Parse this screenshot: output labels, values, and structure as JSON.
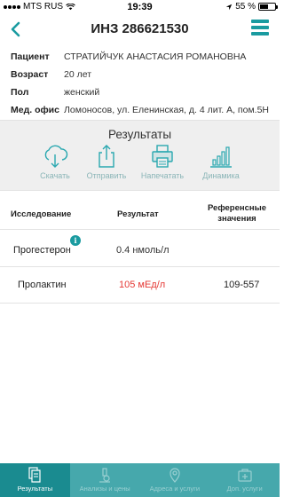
{
  "status_bar": {
    "carrier": "MTS RUS",
    "time": "19:39",
    "battery": "55 %",
    "battery_level": 0.55
  },
  "header": {
    "title": "ИНЗ 286621530"
  },
  "patient": {
    "rows": [
      {
        "label": "Пациент",
        "value": "СТРАТИЙЧУК АНАСТАСИЯ РОМАНОВНА"
      },
      {
        "label": "Возраст",
        "value": "20 лет"
      },
      {
        "label": "Пол",
        "value": "женский"
      },
      {
        "label": "Мед. офис",
        "value": "Ломоносов, ул. Еленинская, д. 4 лит. А, пом.5Н"
      }
    ]
  },
  "results_panel": {
    "title": "Результаты",
    "actions": [
      {
        "label": "Скачать",
        "icon": "cloud-download-icon"
      },
      {
        "label": "Отправить",
        "icon": "share-icon"
      },
      {
        "label": "Напечатать",
        "icon": "printer-icon"
      },
      {
        "label": "Динамика",
        "icon": "bar-chart-icon"
      }
    ]
  },
  "table": {
    "headers": {
      "study": "Исследование",
      "result": "Результат",
      "reference": "Референсные значения"
    },
    "rows": [
      {
        "study": "Прогестерон",
        "result": "0.4 нмоль/л",
        "reference": "",
        "info_badge": "i",
        "result_color": "#333333"
      },
      {
        "study": "Пролактин",
        "result": "105 мЕд/л",
        "reference": "109-557",
        "info_badge": "",
        "result_color": "#e53935"
      }
    ]
  },
  "tab_bar": {
    "tabs": [
      {
        "label": "Результаты",
        "icon": "documents-icon",
        "active": true
      },
      {
        "label": "Анализы и цены",
        "icon": "microscope-icon",
        "active": false
      },
      {
        "label": "Адреса и услуги",
        "icon": "map-pin-icon",
        "active": false
      },
      {
        "label": "Доп. услуги",
        "icon": "medical-case-icon",
        "active": false
      }
    ]
  },
  "colors": {
    "accent": "#1a9ba0",
    "tab_bar": "#46a8ac",
    "tab_active": "#1a8b90",
    "action_icon": "#2aa8b0",
    "action_label": "#8ab5b7",
    "out_of_range": "#e53935"
  }
}
